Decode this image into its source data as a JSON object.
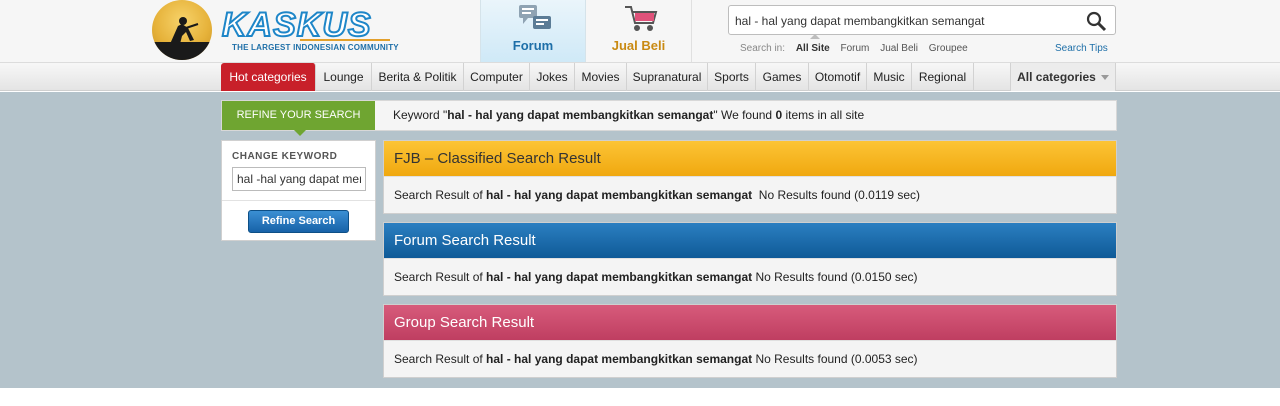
{
  "header": {
    "logo_word": "KASKUS",
    "logo_tagline": "THE LARGEST INDONESIAN COMMUNITY",
    "tabs": [
      {
        "label": "Forum",
        "icon": "forum-icon"
      },
      {
        "label": "Jual Beli",
        "icon": "shopping-cart-icon"
      }
    ],
    "search": {
      "value": "hal - hal yang dapat membangkitkan semangat",
      "search_in_label": "Search in:",
      "options": [
        "All Site",
        "Forum",
        "Jual Beli",
        "Groupee"
      ],
      "active_option": "All Site",
      "tips_label": "Search Tips"
    }
  },
  "categories": {
    "items": [
      "Hot categories",
      "Lounge",
      "Berita & Politik",
      "Computer",
      "Jokes",
      "Movies",
      "Supranatural",
      "Sports",
      "Games",
      "Otomotif",
      "Music",
      "Regional"
    ],
    "all_label": "All categories"
  },
  "refine": {
    "label": "REFINE YOUR SEARCH",
    "msg_prefix": "Keyword \"",
    "keyword": "hal - hal yang dapat membangkitkan semangat",
    "msg_middle": "\" We found ",
    "count": "0",
    "msg_suffix": " items in all site"
  },
  "sidebar": {
    "title": "CHANGE KEYWORD",
    "input_value": "hal -hal yang dapat membangkitkan semangat",
    "button_label": "Refine Search"
  },
  "results": [
    {
      "title": "FJB – Classified Search Result",
      "prefix": "Search Result of ",
      "keyword": "hal - hal yang dapat membangkitkan semangat",
      "suffix": "  No Results found (0.0119 sec)"
    },
    {
      "title": "Forum Search Result",
      "prefix": "Search Result of ",
      "keyword": "hal - hal yang dapat membangkitkan semangat",
      "suffix": " No Results found (0.0150 sec)"
    },
    {
      "title": "Group Search Result",
      "prefix": "Search Result of ",
      "keyword": "hal - hal yang dapat membangkitkan semangat",
      "suffix": " No Results found (0.0053 sec)"
    }
  ],
  "colors": {
    "brand_blue": "#1e86c8",
    "refine_green": "#6fa531",
    "fjb_yellow": "#f0a80f",
    "forum_blue": "#0f5a97",
    "group_pink": "#bf3e61",
    "hot_red": "#c8202a"
  }
}
